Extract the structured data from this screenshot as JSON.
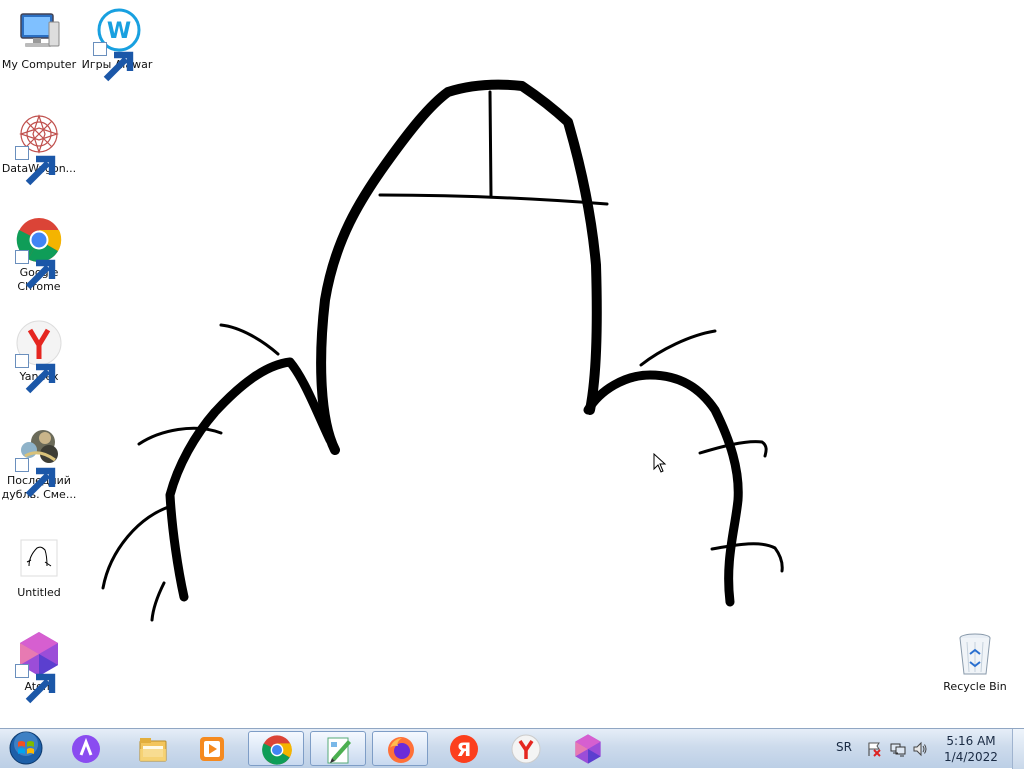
{
  "desktop": {
    "icons": [
      {
        "id": "my-computer",
        "label": "My Computer",
        "icon": "computer-icon",
        "shortcut": false
      },
      {
        "id": "alawar",
        "label": "Игры Alawar",
        "icon": "alawar-icon",
        "shortcut": true
      },
      {
        "id": "datawagon",
        "label": "DataWagon...",
        "icon": "datawagon-icon",
        "shortcut": true
      },
      {
        "id": "chrome",
        "label": "Google Chrome",
        "icon": "chrome-icon",
        "shortcut": true
      },
      {
        "id": "yandex",
        "label": "Yandex",
        "icon": "yandex-browser-icon",
        "shortcut": true
      },
      {
        "id": "game",
        "label": "Последний дубль. Сме...",
        "icon": "game-icon",
        "shortcut": true
      },
      {
        "id": "untitled",
        "label": "Untitled",
        "icon": "image-file-icon",
        "shortcut": false
      },
      {
        "id": "atom",
        "label": "Atom",
        "icon": "atom-icon",
        "shortcut": true
      },
      {
        "id": "recycle-bin",
        "label": "Recycle Bin",
        "icon": "recycle-bin-icon",
        "shortcut": false
      }
    ]
  },
  "taskbar": {
    "start": "start-orb-icon",
    "pinned": [
      {
        "id": "alice",
        "icon": "alice-assistant-icon",
        "active": false
      },
      {
        "id": "explorer",
        "icon": "folder-icon",
        "active": false
      },
      {
        "id": "media-player",
        "icon": "media-player-icon",
        "active": false
      },
      {
        "id": "chrome",
        "icon": "chrome-icon",
        "active": true
      },
      {
        "id": "paint",
        "icon": "paint-icon",
        "active": true
      },
      {
        "id": "firefox",
        "icon": "firefox-icon",
        "active": true
      },
      {
        "id": "yandex-ya",
        "icon": "yandex-ya-icon",
        "active": false
      },
      {
        "id": "yandex-browser",
        "icon": "yandex-browser-icon",
        "active": false
      },
      {
        "id": "atom",
        "icon": "atom-icon",
        "active": false
      }
    ],
    "tray": {
      "language": "SR",
      "time": "5:16 AM",
      "date": "1/4/2022",
      "icons": [
        "action-center-flag-icon",
        "network-icon",
        "volume-icon"
      ]
    }
  },
  "colors": {
    "taskbar_top": "#e6eef8",
    "taskbar_bottom": "#bccfe6",
    "ink": "#000000"
  }
}
